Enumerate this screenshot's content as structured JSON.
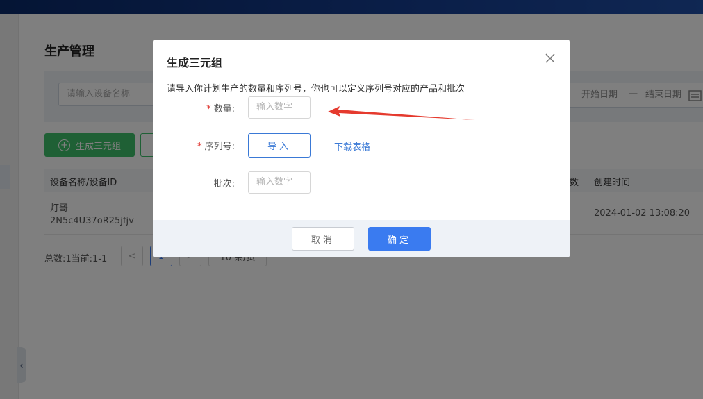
{
  "background": {
    "page_title": "生产管理",
    "search_placeholder": "请输入设备名称",
    "date_start": "开始日期",
    "date_sep": "一",
    "date_end": "结束日期",
    "generate_button": "生成三元组",
    "table": {
      "col_device": "设备名称/设备ID",
      "col_partial": "数",
      "col_created": "创建时间",
      "row": {
        "device_name": "灯哥",
        "device_id": "2N5c4U37oR25jfjv",
        "created": "2024-01-02 13:08:20"
      }
    },
    "pagination": {
      "total": "总数:1当前:1-1",
      "prev": "<",
      "page": "1",
      "next": ">",
      "page_size": "10 条/页"
    }
  },
  "modal": {
    "title": "生成三元组",
    "close_icon": "close-icon",
    "description": "请导入你计划生产的数量和序列号，你也可以定义序列号对应的产品和批次",
    "quantity_label": "数量:",
    "quantity_placeholder": "输入数字",
    "serial_label": "序列号:",
    "import_button": "导入",
    "download_link": "下载表格",
    "batch_label": "批次:",
    "batch_placeholder": "输入数字",
    "cancel_button": "取消",
    "confirm_button": "确定"
  },
  "colors": {
    "primary": "#3a7bf0",
    "success": "#3ec06a",
    "required": "#e0302a",
    "annotation_arrow": "#e53a2e"
  }
}
